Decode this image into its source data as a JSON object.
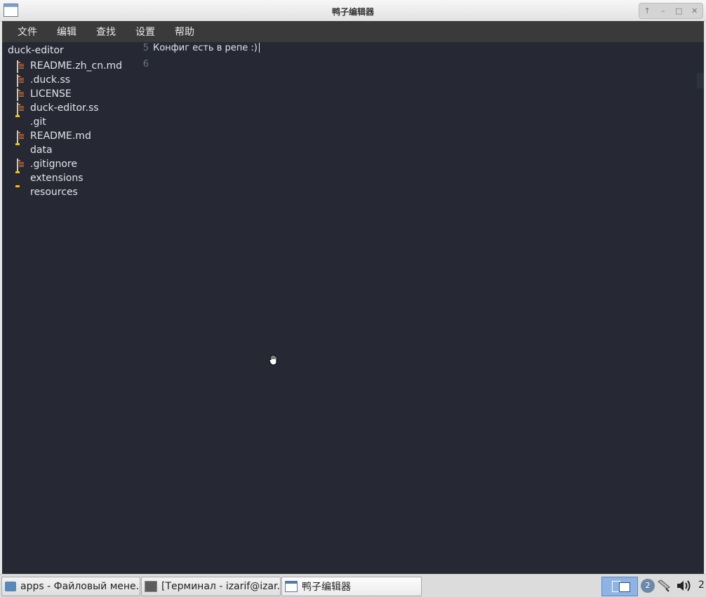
{
  "window": {
    "title": "鸭子编辑器",
    "controls": [
      "↑",
      "–",
      "□",
      "✕"
    ]
  },
  "menu": [
    {
      "label": "文件"
    },
    {
      "label": "编辑"
    },
    {
      "label": "查找"
    },
    {
      "label": "设置"
    },
    {
      "label": "帮助"
    }
  ],
  "sidebar": {
    "root": "duck-editor",
    "items": [
      {
        "name": "README.zh_cn.md",
        "type": "file"
      },
      {
        "name": ".duck.ss",
        "type": "file"
      },
      {
        "name": "LICENSE",
        "type": "file"
      },
      {
        "name": "duck-editor.ss",
        "type": "file"
      },
      {
        "name": ".git",
        "type": "folder"
      },
      {
        "name": "README.md",
        "type": "file"
      },
      {
        "name": "data",
        "type": "folder"
      },
      {
        "name": ".gitignore",
        "type": "file"
      },
      {
        "name": "extensions",
        "type": "folder"
      },
      {
        "name": "resources",
        "type": "folder"
      }
    ]
  },
  "editor": {
    "lines": [
      {
        "number": "5",
        "text": "Конфиг есть в репе :)"
      },
      {
        "number": "6",
        "text": ""
      }
    ],
    "cursor_line": 0
  },
  "taskbar": {
    "tasks": [
      {
        "label": "apps - Файловый мене...",
        "icon": "folder-icon"
      },
      {
        "label": "[Терминал - izarif@izar...",
        "icon": "terminal-icon"
      },
      {
        "label": "鸭子编辑器",
        "icon": "window-icon"
      }
    ],
    "notification_count": "2",
    "clock": "2"
  },
  "colors": {
    "editor_bg": "#262933",
    "menubar_bg": "#3a3a3a",
    "text": "#e1e4ea",
    "line_number": "#6c7389",
    "folder": "#f7c200"
  }
}
